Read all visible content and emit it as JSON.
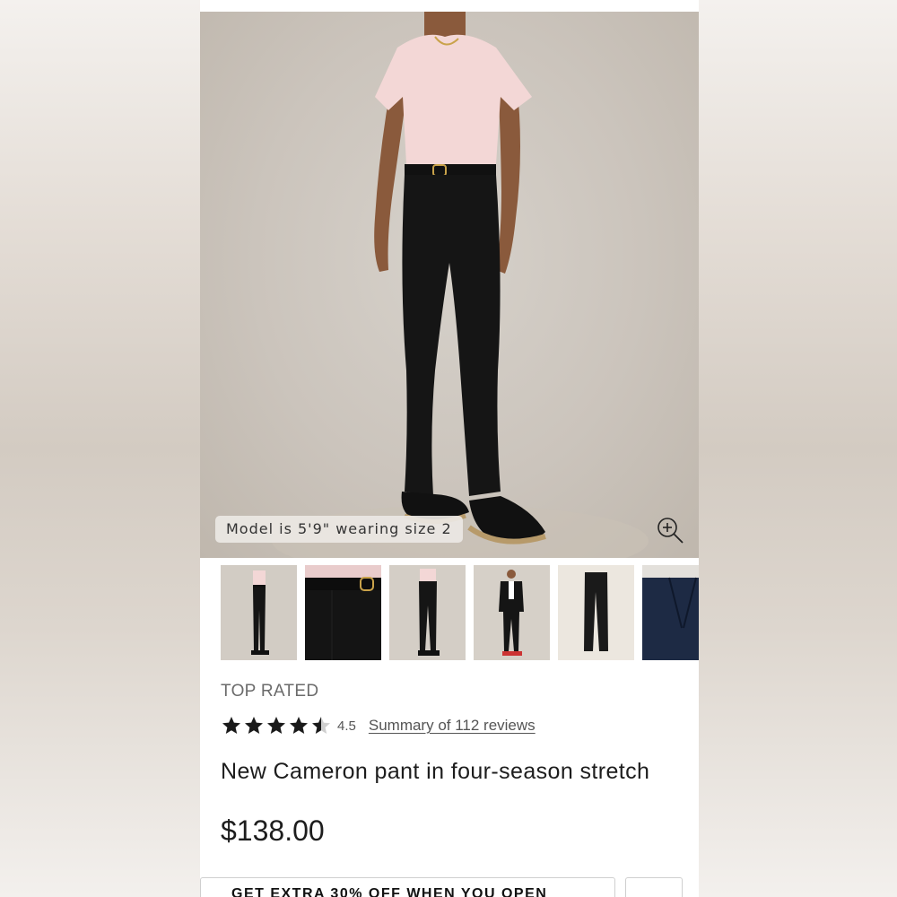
{
  "gallery": {
    "caption": "Model is 5'9\" wearing size 2",
    "zoom_icon": "zoom-in-icon",
    "thumbnails": [
      {
        "label": "Front full-length view"
      },
      {
        "label": "Waist belt detail"
      },
      {
        "label": "Back view"
      },
      {
        "label": "Styled with black blazer"
      },
      {
        "label": "Flat lay product"
      },
      {
        "label": "Navy color option"
      }
    ]
  },
  "product": {
    "badge": "TOP RATED",
    "rating": 4.5,
    "rating_text": "4.5",
    "reviews_link": "Summary of 112 reviews",
    "title": "New Cameron pant in four-season stretch",
    "price": "$138.00"
  },
  "actions": {
    "promo_label": "GET EXTRA 30% OFF WHEN YOU OPEN"
  },
  "colors": {
    "star": "#1a1a1a",
    "text_dark": "#1d1d1d",
    "text_muted": "#6b6b6b"
  }
}
